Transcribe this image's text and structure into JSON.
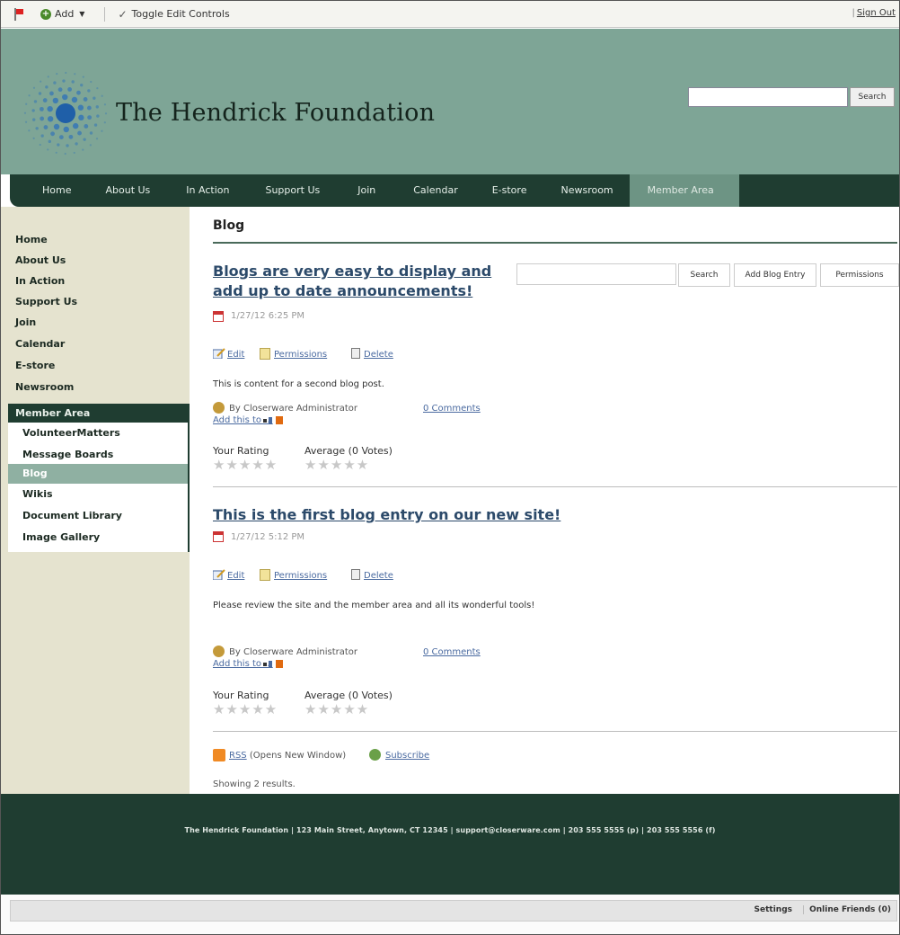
{
  "dock": {
    "add_label": "Add",
    "add_caret": "▼",
    "toggle_label": "Toggle Edit Controls",
    "toggle_check": "✓",
    "signout_label": "Sign Out"
  },
  "header": {
    "site_title": "The Hendrick Foundation",
    "search_button": "Search"
  },
  "nav": [
    {
      "label": "Home"
    },
    {
      "label": "About Us"
    },
    {
      "label": "In Action"
    },
    {
      "label": "Support Us"
    },
    {
      "label": "Join"
    },
    {
      "label": "Calendar"
    },
    {
      "label": "E-store"
    },
    {
      "label": "Newsroom"
    },
    {
      "label": "Member Area",
      "active": true
    }
  ],
  "sidebar": {
    "items": [
      "Home",
      "About Us",
      "In Action",
      "Support Us",
      "Join",
      "Calendar",
      "E-store",
      "Newsroom"
    ],
    "active_section": "Member Area",
    "subitems": [
      "VolunteerMatters",
      "Message Boards",
      "Blog",
      "Wikis",
      "Document Library",
      "Image Gallery"
    ],
    "active_subitem": "Blog"
  },
  "main": {
    "heading": "Blog",
    "search_button": "Search",
    "add_entry_button": "Add Blog Entry",
    "permissions_button": "Permissions",
    "posts": [
      {
        "title_line1": "Blogs are very easy to display and",
        "title_line2": "add up to date announcements!",
        "date": "1/27/12 6:25 PM",
        "edit": "Edit",
        "permissions": "Permissions",
        "delete": "Delete",
        "body": "This is content for a second blog post.",
        "author": "By Closerware Administrator",
        "comments": "0 Comments",
        "add_this": "Add this to ...",
        "your_rating": "Your Rating",
        "average": "Average (0 Votes)"
      },
      {
        "title_line1": "This is the first blog entry on our new site!",
        "date": "1/27/12 5:12 PM",
        "edit": "Edit",
        "permissions": "Permissions",
        "delete": "Delete",
        "body": "Please review the site and the member area and all its wonderful tools!",
        "author": "By Closerware Administrator",
        "comments": "0 Comments",
        "add_this": "Add this to ...",
        "your_rating": "Your Rating",
        "average": "Average (0 Votes)"
      }
    ],
    "stars": "★★★★★",
    "rss_label": "RSS",
    "rss_note": "(Opens New Window)",
    "subscribe_label": "Subscribe",
    "results": "Showing 2 results."
  },
  "footer": {
    "text": "The Hendrick Foundation | 123 Main Street, Anytown, CT 12345 | support@closerware.com | 203 555 5555 (p) | 203 555 5556 (f)"
  },
  "bottom": {
    "settings": "Settings",
    "online_friends": "Online Friends (0)"
  }
}
